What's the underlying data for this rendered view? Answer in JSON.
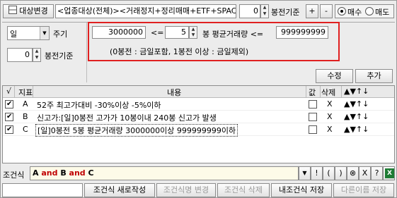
{
  "topbar": {
    "target_change_label": "대상변경",
    "target_text": "<업종대상(전체)><거래정지+정리매매+ETF+SPAC",
    "bar_offset_value": "0",
    "bar_base_label": "봉전기준",
    "plus_label": "+",
    "minus_label": "-",
    "buy_label": "매수",
    "sell_label": "매도",
    "selected_side": "buy"
  },
  "left": {
    "period_value": "일",
    "period_label": "주기",
    "bar_offset_value": "0",
    "bar_base_label": "봉전기준"
  },
  "condition": {
    "min_value": "3000000",
    "lte1": "<=",
    "bars_value": "5",
    "mid_label": "봉 평균거래량 <=",
    "max_value": "999999999",
    "note": "(0봉전 : 금일포함, 1봉전 이상 : 금일제외)"
  },
  "buttons": {
    "modify": "수정",
    "add": "추가"
  },
  "table": {
    "headers": {
      "check": "√",
      "index": "지표",
      "content": "내용",
      "value": "값",
      "delete": "삭제"
    },
    "rows": [
      {
        "checked": true,
        "index": "A",
        "content": "52주 최고가대비 -30%이상 -5%이하",
        "delete": "X"
      },
      {
        "checked": true,
        "index": "B",
        "content": "신고가:[일]0봉전 고가가 10봉이내 240봉 신고가 발생",
        "delete": "X"
      },
      {
        "checked": true,
        "index": "C",
        "content": "[일]0봉전 5봉 평균거래량 3000000이상 999999999이하",
        "delete": "X",
        "selected": true
      }
    ]
  },
  "formula": {
    "label": "조건식",
    "tokens": [
      {
        "text": "A",
        "color": "#000000"
      },
      {
        "text": " and ",
        "color": "#c00000"
      },
      {
        "text": "B",
        "color": "#000000"
      },
      {
        "text": " and ",
        "color": "#c00000"
      },
      {
        "text": "C",
        "color": "#000000"
      }
    ],
    "tool_buttons": [
      "▼",
      "!",
      "(",
      ")",
      "⊗",
      "X",
      "?"
    ]
  },
  "bottom": {
    "name_value": "",
    "new_label": "조건식 새로작성",
    "rename_label": "조건식명 변경",
    "delete_label": "조건식 삭제",
    "save_label": "내조건식 저장",
    "save_as_label": "다른이름 저장"
  },
  "colors": {
    "highlight_red": "#e02020",
    "selected_row": "#0a246a",
    "excel_green": "#1e7b34"
  }
}
